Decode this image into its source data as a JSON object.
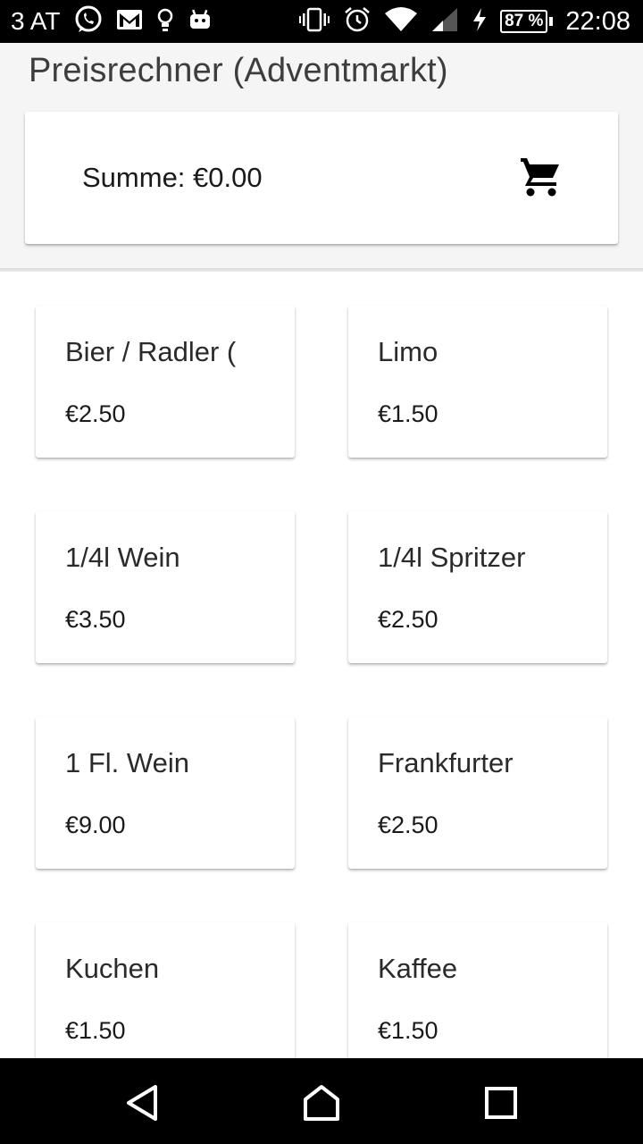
{
  "status_bar": {
    "carrier": "3 AT",
    "battery": "87 %",
    "time": "22:08"
  },
  "header": {
    "title": "Preisrechner (Adventmarkt)"
  },
  "summary": {
    "total_label": "Summe: €0.00",
    "cart_icon": "shopping-cart-icon"
  },
  "products": [
    {
      "name": "Bier / Radler (",
      "price": "€2.50"
    },
    {
      "name": "Limo",
      "price": "€1.50"
    },
    {
      "name": "1/4l Wein",
      "price": "€3.50"
    },
    {
      "name": "1/4l Spritzer",
      "price": "€2.50"
    },
    {
      "name": "1 Fl. Wein",
      "price": "€9.00"
    },
    {
      "name": "Frankfurter",
      "price": "€2.50"
    },
    {
      "name": "Kuchen",
      "price": "€1.50"
    },
    {
      "name": "Kaffee",
      "price": "€1.50"
    }
  ],
  "nav_bar": {
    "back_icon": "back-triangle-icon",
    "home_icon": "home-icon",
    "recents_icon": "recents-square-icon"
  }
}
